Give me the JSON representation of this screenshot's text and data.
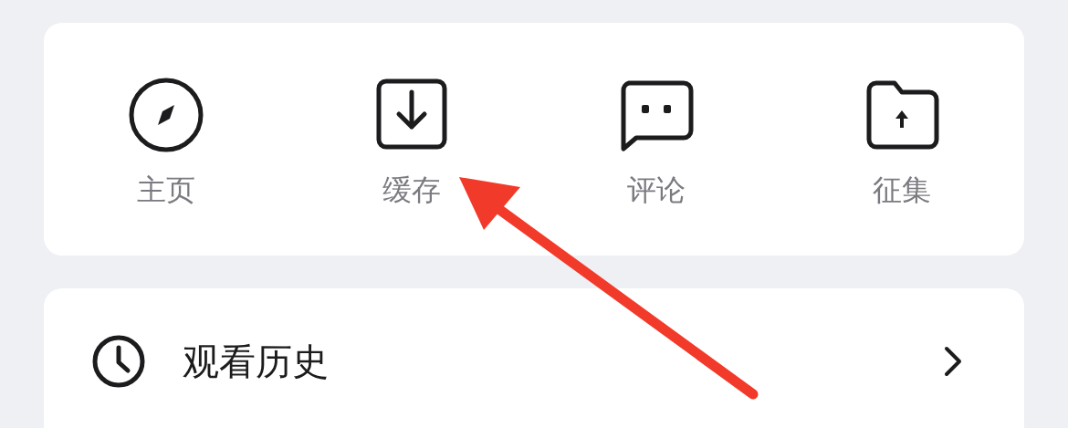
{
  "shortcuts": [
    {
      "kind": "compass",
      "label": "主页"
    },
    {
      "kind": "download",
      "label": "缓存"
    },
    {
      "kind": "comment",
      "label": "评论"
    },
    {
      "kind": "folder-upload",
      "label": "征集"
    }
  ],
  "menu": [
    {
      "kind": "history",
      "label": "观看历史"
    }
  ]
}
